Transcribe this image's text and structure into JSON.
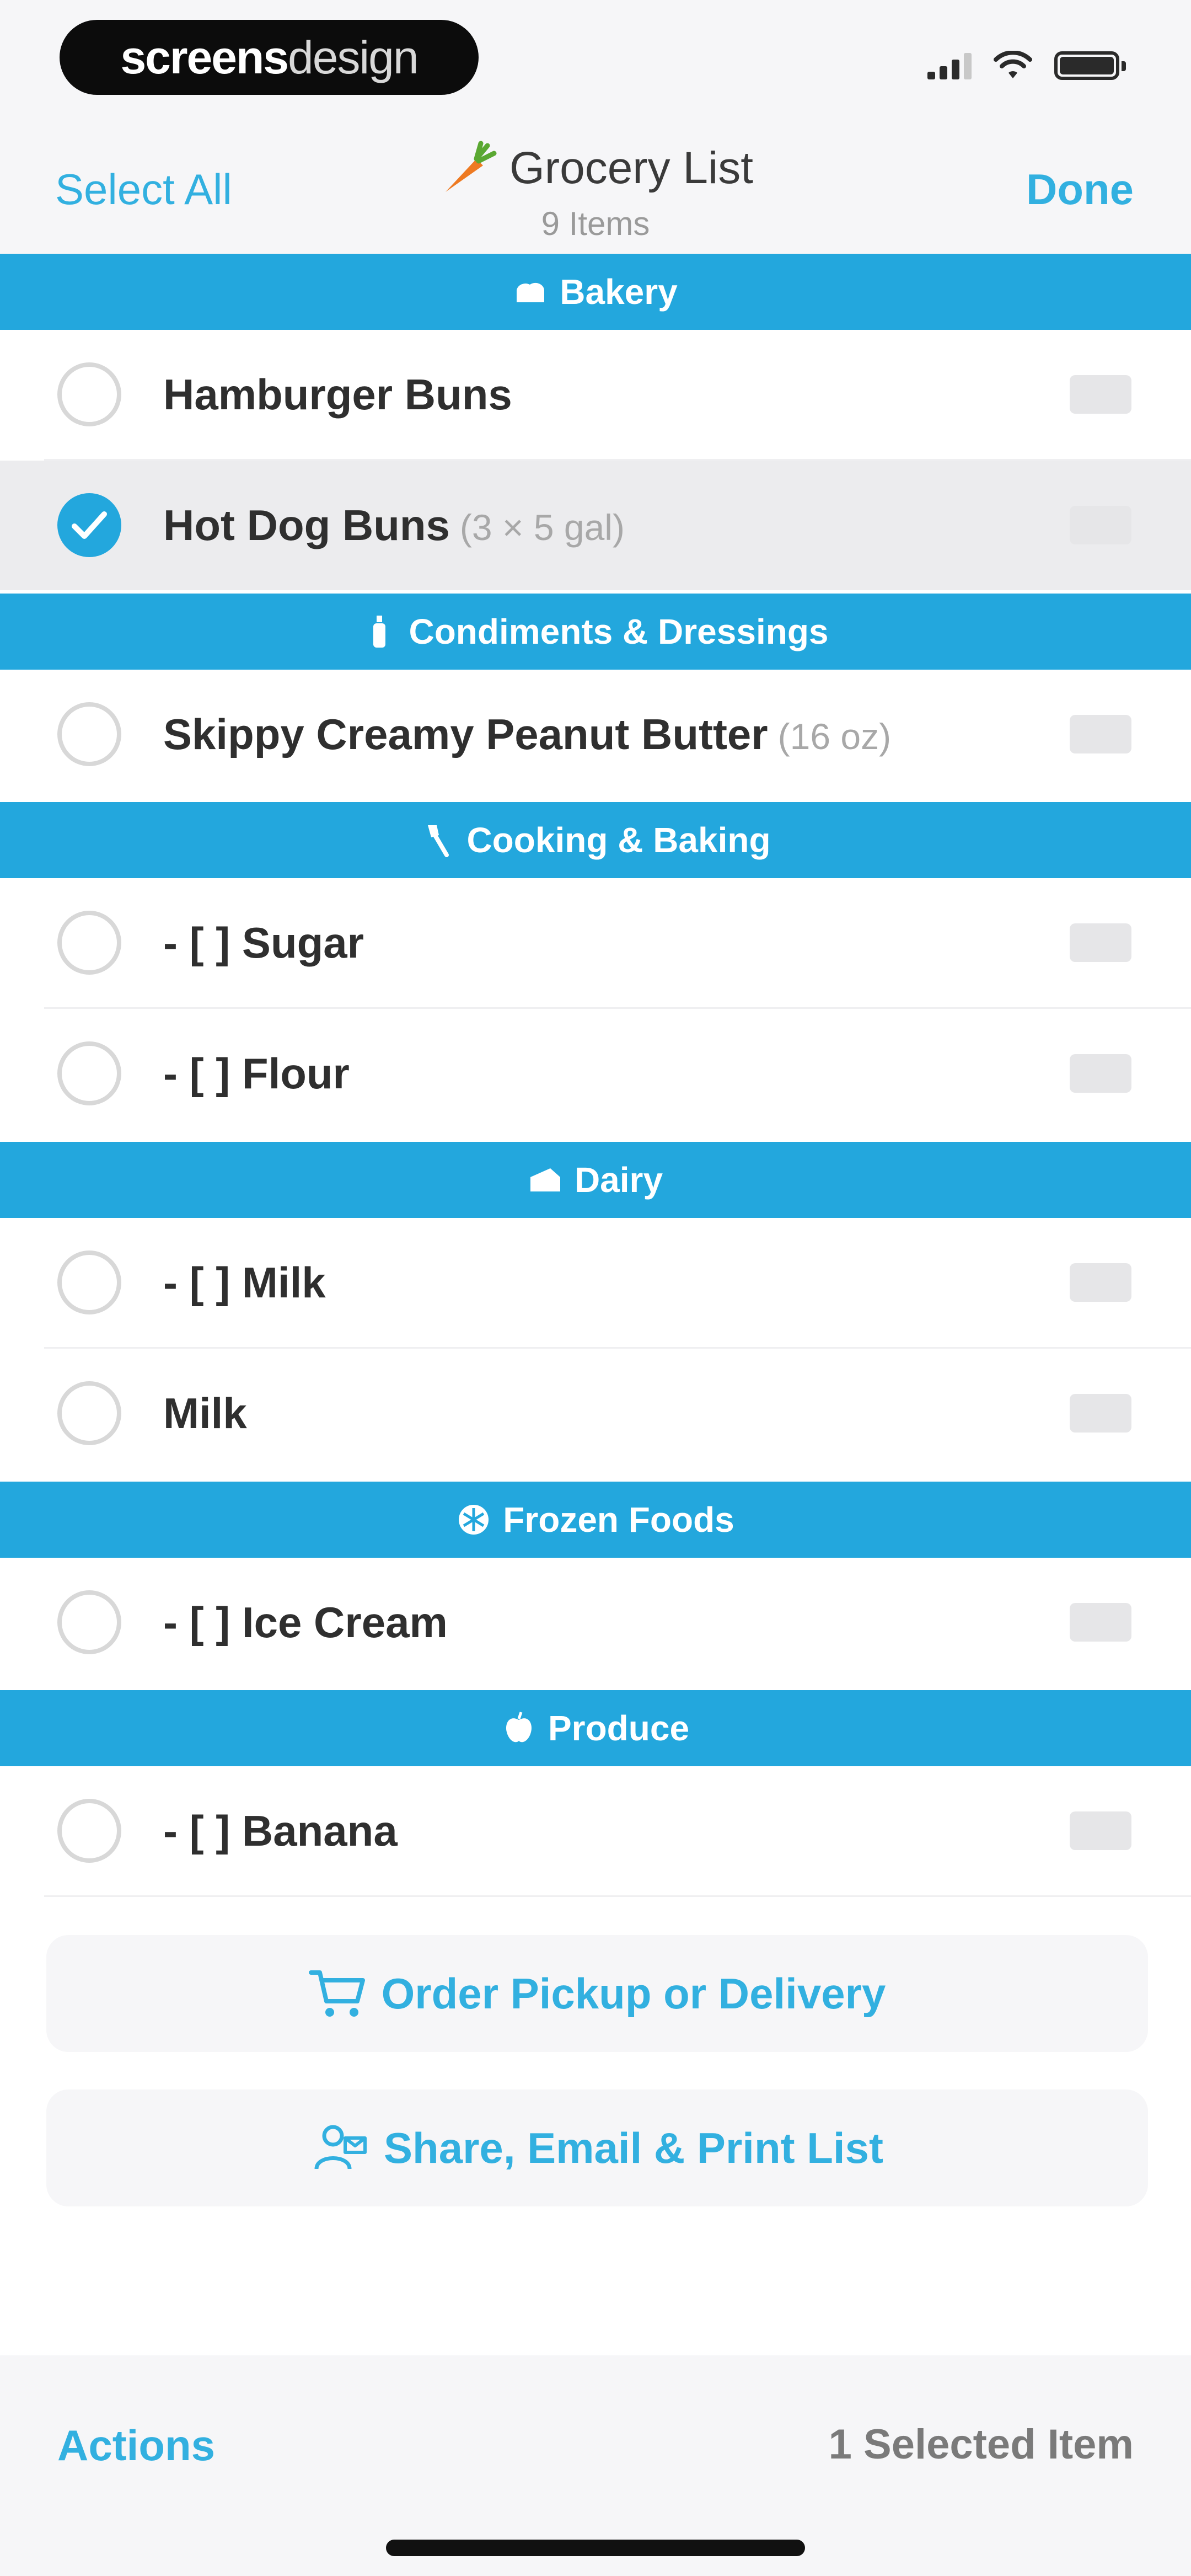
{
  "status_bar": {
    "logo_bold": "screens",
    "logo_light": "design",
    "icons": [
      "signal-icon",
      "wifi-icon",
      "battery-icon"
    ]
  },
  "nav": {
    "left_label": "Select All",
    "title": "Grocery List",
    "subtitle": "9 Items",
    "right_label": "Done",
    "title_icon": "carrot-icon"
  },
  "sections": [
    {
      "title": "Bakery",
      "icon": "bread-icon",
      "items": [
        {
          "name": "Hamburger Buns",
          "qty": "",
          "checked": false
        },
        {
          "name": "Hot Dog Buns",
          "qty": "(3 × 5 gal)",
          "checked": true
        }
      ]
    },
    {
      "title": "Condiments & Dressings",
      "icon": "bottle-icon",
      "items": [
        {
          "name": "Skippy Creamy Peanut Butter",
          "qty": "(16 oz)",
          "checked": false
        }
      ]
    },
    {
      "title": "Cooking & Baking",
      "icon": "spatula-icon",
      "items": [
        {
          "name": "- [ ] Sugar",
          "qty": "",
          "checked": false
        },
        {
          "name": "- [ ] Flour",
          "qty": "",
          "checked": false
        }
      ]
    },
    {
      "title": "Dairy",
      "icon": "cheese-icon",
      "items": [
        {
          "name": "- [ ] Milk",
          "qty": "",
          "checked": false
        },
        {
          "name": "Milk",
          "qty": "",
          "checked": false
        }
      ]
    },
    {
      "title": "Frozen Foods",
      "icon": "snowflake-icon",
      "items": [
        {
          "name": "- [ ] Ice Cream",
          "qty": "",
          "checked": false
        }
      ]
    },
    {
      "title": "Produce",
      "icon": "apple-icon",
      "items": [
        {
          "name": "- [ ] Banana",
          "qty": "",
          "checked": false
        }
      ]
    }
  ],
  "actions": {
    "order_label": "Order Pickup or Delivery",
    "share_label": "Share, Email & Print List"
  },
  "toolbar": {
    "left_label": "Actions",
    "right_label": "1 Selected Item"
  },
  "colors": {
    "accent": "#23a7dd",
    "link": "#32b0e0",
    "selected_row": "#ececee"
  }
}
